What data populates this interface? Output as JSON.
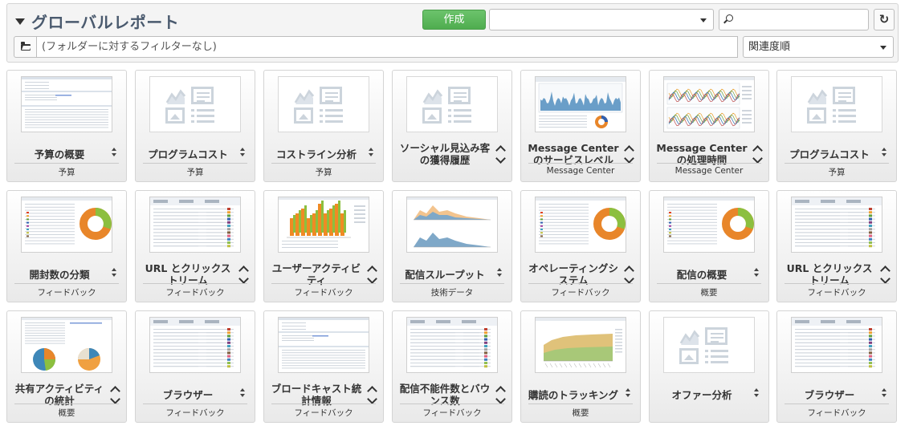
{
  "header": {
    "title": "グローバルレポート",
    "create_label": "作成",
    "type_filter_value": "",
    "search_value": "",
    "refresh_icon": "refresh-icon",
    "folder_filter_text": "(フォルダーに対するフィルターなし)",
    "sort_value": "関連度順"
  },
  "cards": [
    {
      "title": "予算の概要",
      "category": "予算",
      "thumb": "doc"
    },
    {
      "title": "プログラムコスト",
      "category": "予算",
      "thumb": "placeholder"
    },
    {
      "title": "コストライン分析",
      "category": "予算",
      "thumb": "placeholder"
    },
    {
      "title": "ソーシャル見込み客の獲得履歴",
      "category": "",
      "thumb": "placeholder"
    },
    {
      "title": "Message Center のサービスレベル",
      "category": "Message Center",
      "thumb": "area-blue"
    },
    {
      "title": "Message Center の処理時間",
      "category": "Message Center",
      "thumb": "lines-multi"
    },
    {
      "title": "プログラムコスト",
      "category": "予算",
      "thumb": "placeholder"
    },
    {
      "title": "開封数の分類",
      "category": "フィードバック",
      "thumb": "donut"
    },
    {
      "title": "URL とクリックストリーム",
      "category": "フィードバック",
      "thumb": "table-color"
    },
    {
      "title": "ユーザーアクティビティ",
      "category": "フィードバック",
      "thumb": "bar3d"
    },
    {
      "title": "配信スループット",
      "category": "技術データ",
      "thumb": "area-orange"
    },
    {
      "title": "オペレーティングシステム",
      "category": "フィードバック",
      "thumb": "donut"
    },
    {
      "title": "配信の概要",
      "category": "概要",
      "thumb": "donut"
    },
    {
      "title": "URL とクリックストリーム",
      "category": "フィードバック",
      "thumb": "table-color"
    },
    {
      "title": "共有アクティビティの統計",
      "category": "概要",
      "thumb": "pies"
    },
    {
      "title": "ブラウザー",
      "category": "フィードバック",
      "thumb": "table-color"
    },
    {
      "title": "ブロードキャスト統計情報",
      "category": "フィードバック",
      "thumb": "doc"
    },
    {
      "title": "配信不能件数とバウンス数",
      "category": "フィードバック",
      "thumb": "table-color"
    },
    {
      "title": "購読のトラッキング",
      "category": "概要",
      "thumb": "area-cumulative"
    },
    {
      "title": "オファー分析",
      "category": "",
      "thumb": "placeholder"
    },
    {
      "title": "ブラウザー",
      "category": "フィードバック",
      "thumb": "table-color"
    }
  ]
}
